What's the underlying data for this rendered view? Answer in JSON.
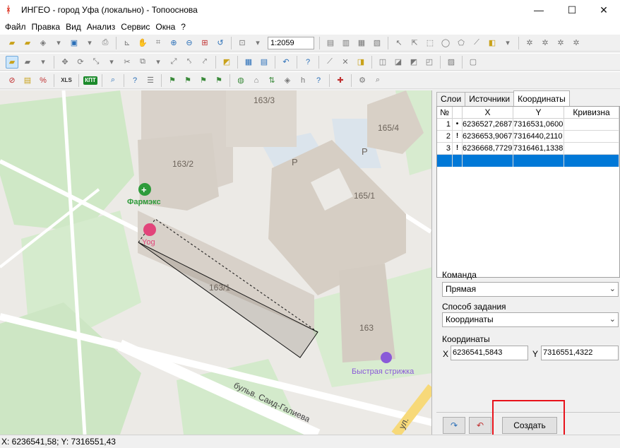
{
  "window": {
    "title": "ИНГЕО - город Уфа (локально) - Топооснова",
    "minimize": "—",
    "maximize": "☐",
    "close": "✕"
  },
  "menu": [
    "Файл",
    "Правка",
    "Вид",
    "Анализ",
    "Сервис",
    "Окна",
    "?"
  ],
  "toolbar": {
    "scale": "1:2059",
    "xls_label": "XLS",
    "kpt_label": "КПТ"
  },
  "map": {
    "labels": {
      "b163_3": "163/3",
      "b165_4": "165/4",
      "b163_2": "163/2",
      "b165_1": "165/1",
      "b163_1": "163/1",
      "b163": "163",
      "parking1": "P",
      "parking2": "P",
      "pharmacy": "Фармэкс",
      "yoga": "Yog",
      "barber": "Быстрая стрижка",
      "street": "бульв. Саид-Галиева",
      "street2": "ул."
    }
  },
  "panel": {
    "tabs": [
      "Слои",
      "Источники",
      "Координаты"
    ],
    "selected_tab": "Координаты",
    "grid": {
      "headers": [
        "№",
        "X",
        "Y",
        "Кривизна"
      ],
      "rows": [
        {
          "n": "1",
          "mark": "•",
          "x": "6236527,2687",
          "y": "7316531,0600"
        },
        {
          "n": "2",
          "mark": "!",
          "x": "6236653,9067",
          "y": "7316440,2110"
        },
        {
          "n": "3",
          "mark": "!",
          "x": "6236668,7729",
          "y": "7316461,1338"
        }
      ]
    },
    "command_label": "Команда",
    "command_value": "Прямая",
    "method_label": "Способ задания",
    "method_value": "Координаты",
    "coords_label": "Координаты",
    "x_label": "X",
    "x_value": "6236541,5843",
    "y_label": "Y",
    "y_value": "7316551,4322",
    "redo_icon": "↷",
    "undo_icon": "↶",
    "create_button": "Создать"
  },
  "status": {
    "coords": "X: 6236541,58; Y: 7316551,43"
  },
  "colors": {
    "accent": "#0078d7",
    "highlight": "#e8121b",
    "pharmacy": "#2e9b3a",
    "yoga": "#e2447a",
    "barber": "#8a5ad8"
  }
}
